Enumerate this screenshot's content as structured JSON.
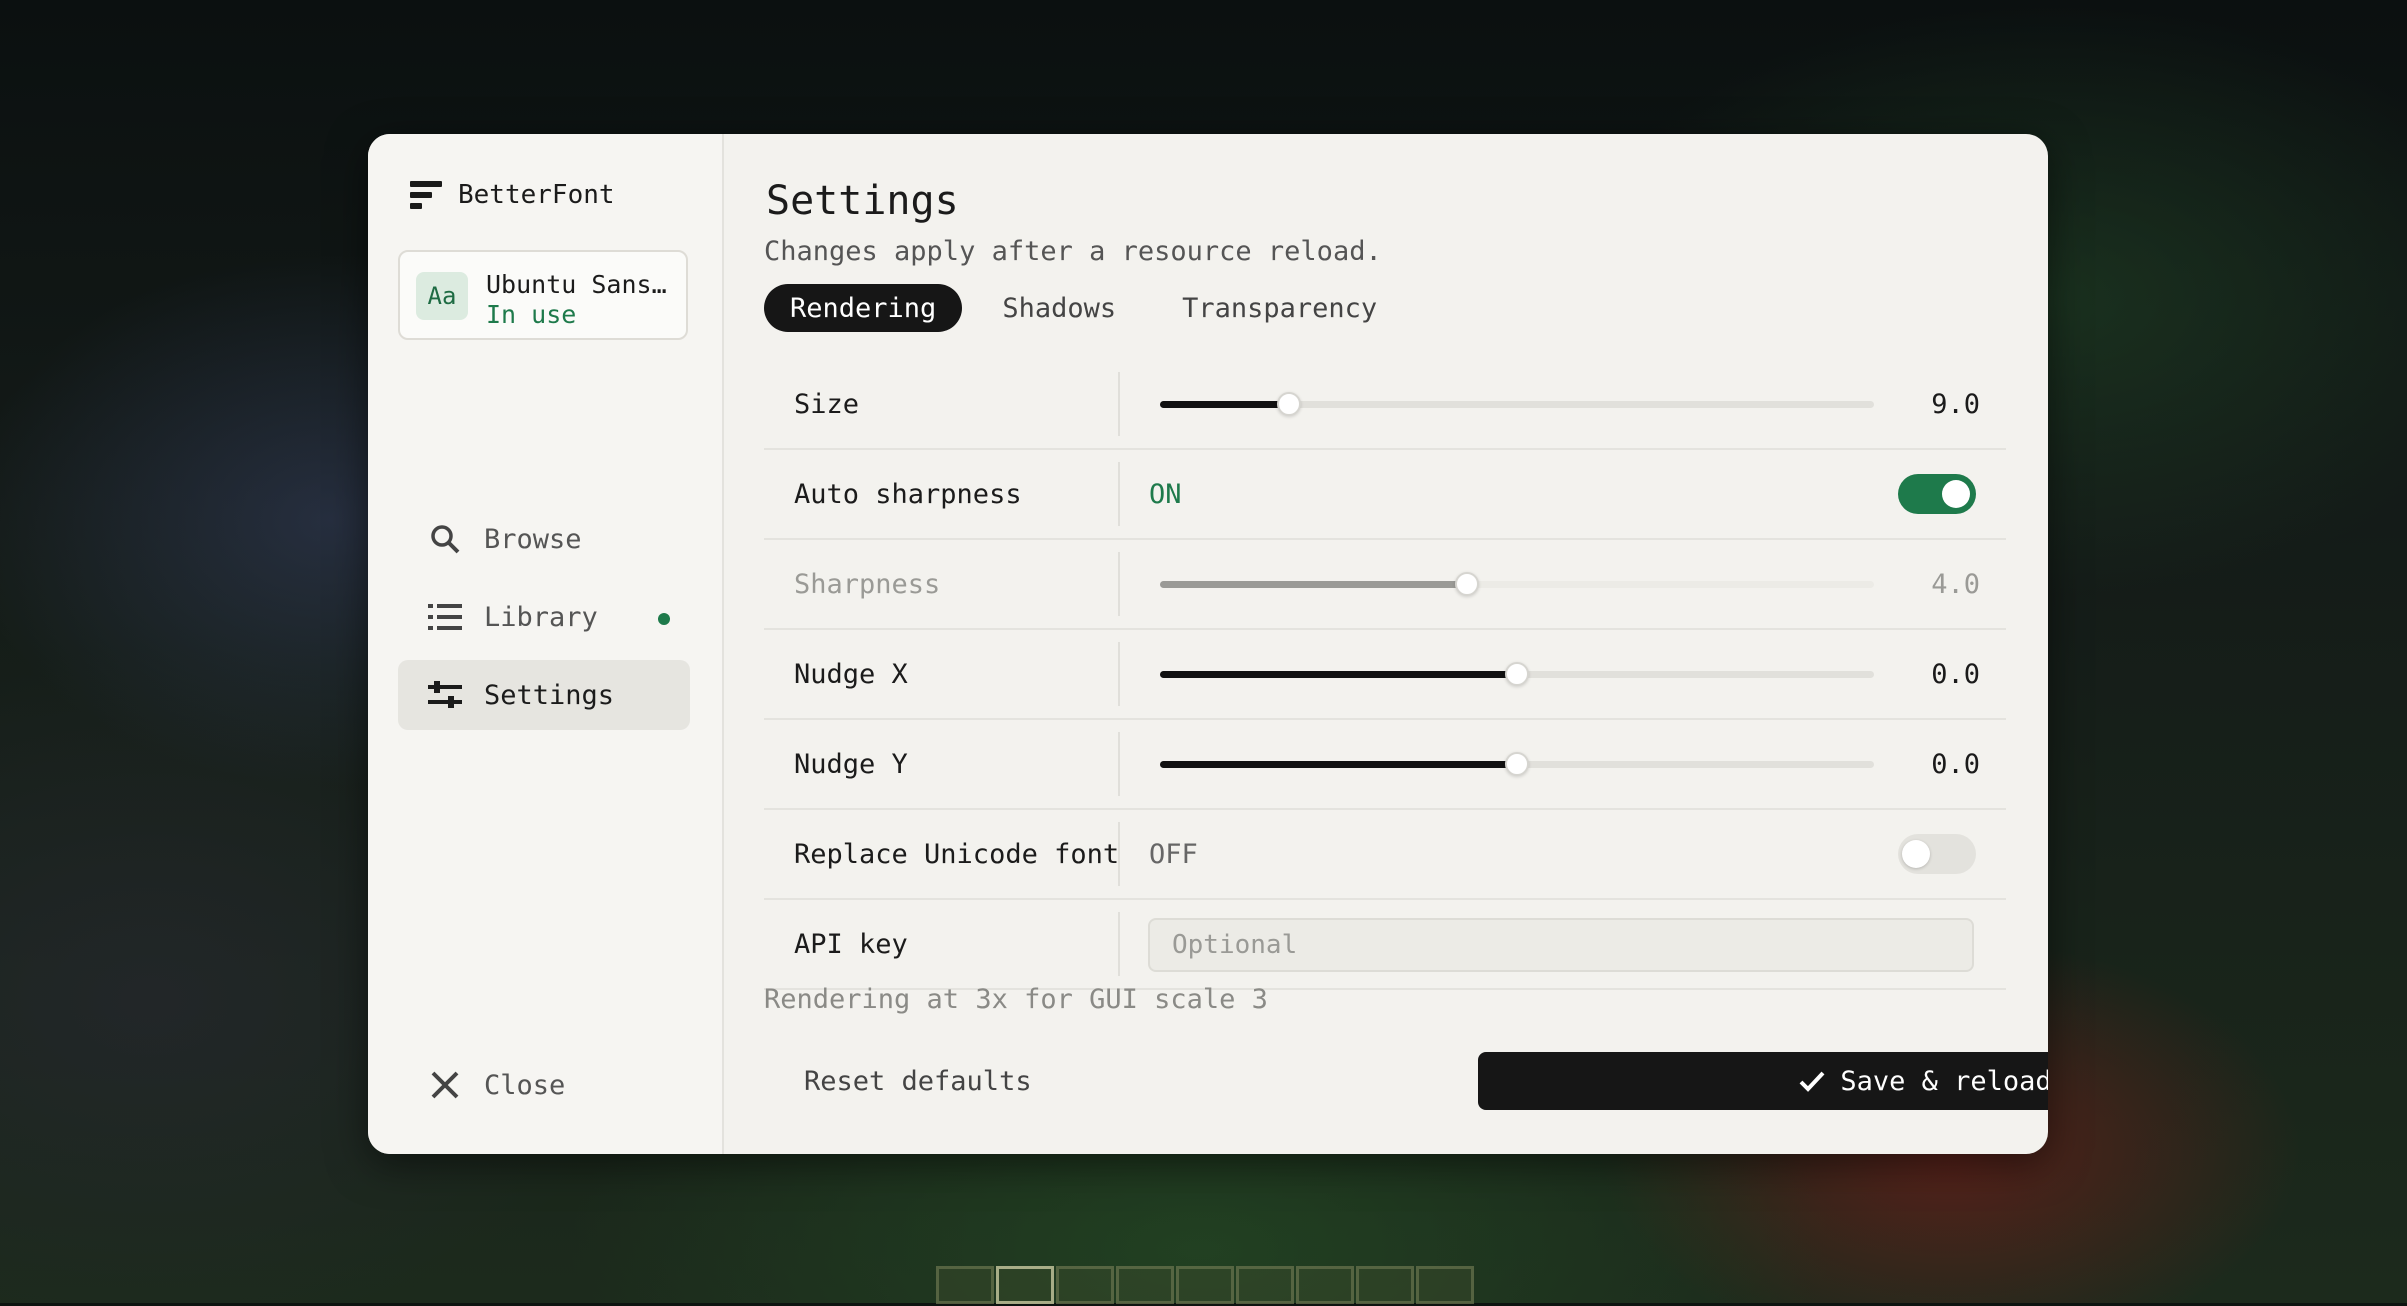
{
  "sidebar": {
    "brand": "BetterFont",
    "font_card": {
      "badge": "Aa",
      "name": "Ubuntu Sans…",
      "status": "In use"
    },
    "items": [
      {
        "label": "Browse",
        "icon": "search-icon"
      },
      {
        "label": "Library",
        "icon": "list-icon",
        "indicator": true
      },
      {
        "label": "Settings",
        "icon": "sliders-icon",
        "active": true
      }
    ],
    "close_label": "Close"
  },
  "main": {
    "title": "Settings",
    "subtitle": "Changes apply after a resource reload.",
    "tabs": [
      {
        "label": "Rendering",
        "active": true
      },
      {
        "label": "Shadows"
      },
      {
        "label": "Transparency"
      }
    ],
    "rows": [
      {
        "label": "Size",
        "type": "slider",
        "value": "9.0",
        "fraction": 0.18
      },
      {
        "label": "Auto sharpness",
        "type": "toggle",
        "state": "ON",
        "on": true
      },
      {
        "label": "Sharpness",
        "type": "slider",
        "value": "4.0",
        "fraction": 0.43,
        "disabled": true
      },
      {
        "label": "Nudge X",
        "type": "slider",
        "value": "0.0",
        "fraction": 0.5
      },
      {
        "label": "Nudge Y",
        "type": "slider",
        "value": "0.0",
        "fraction": 0.5
      },
      {
        "label": "Replace Unicode font",
        "type": "toggle",
        "state": "OFF",
        "on": false
      },
      {
        "label": "API key",
        "type": "input",
        "placeholder": "Optional",
        "value": ""
      }
    ],
    "footer_note": "Rendering at 3x for GUI scale 3",
    "reset_label": "Reset defaults",
    "save_label": "Save & reload"
  },
  "colors": {
    "accent": "#1e7a4b",
    "primary_button": "#161616",
    "panel": "#f3f2ee"
  }
}
